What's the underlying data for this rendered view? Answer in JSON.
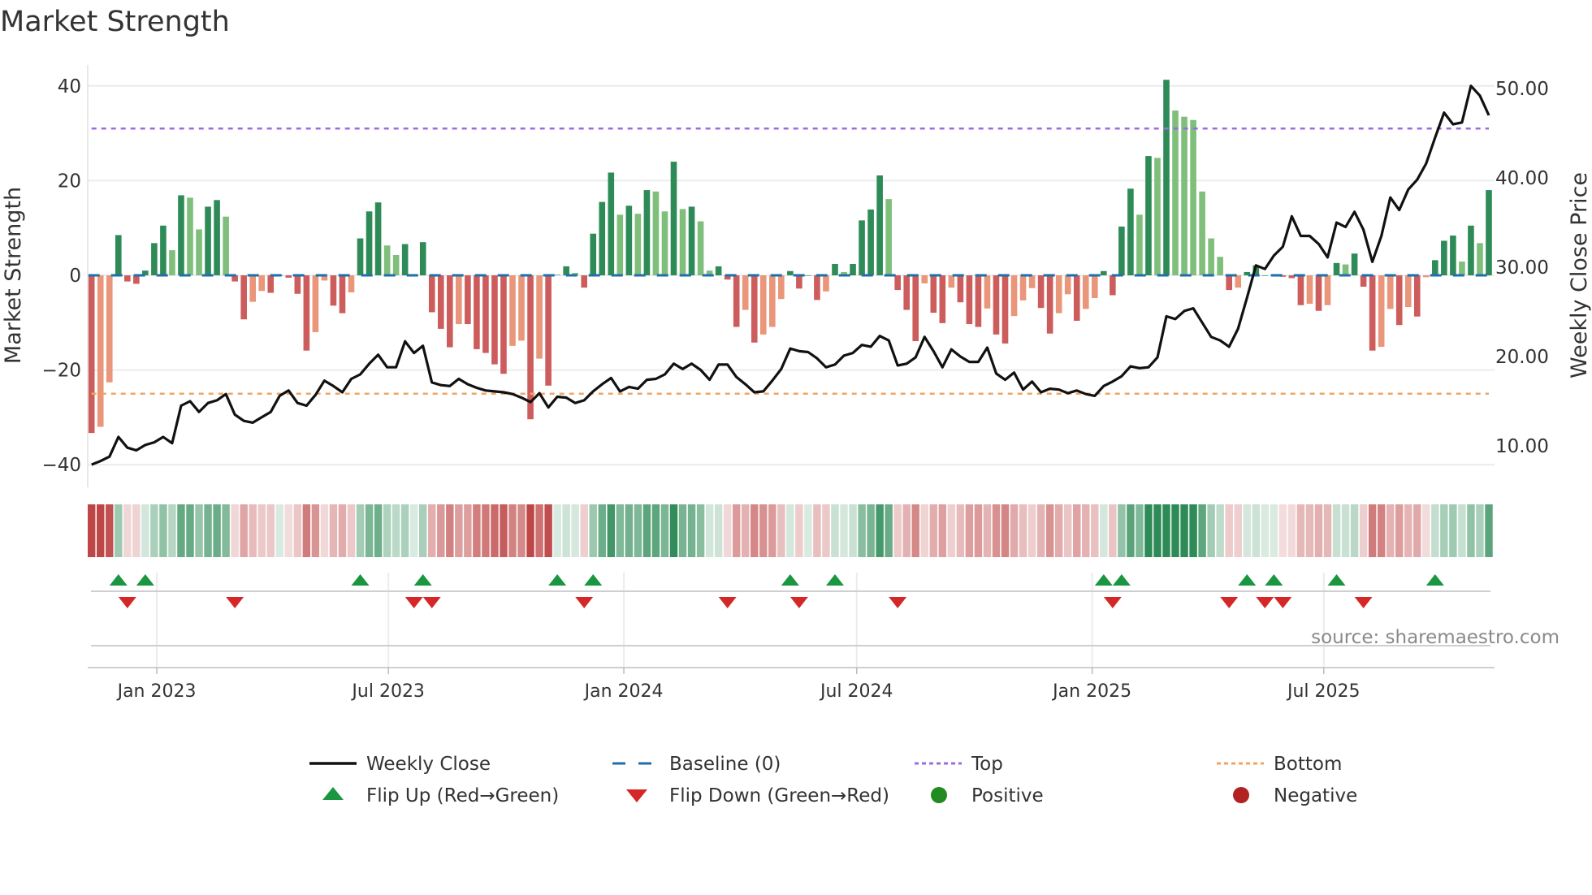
{
  "chart_data": {
    "type": "bar",
    "title": "Market Strength",
    "ylabel": "Market Strength",
    "y2label": "Weekly Close Price",
    "ylim": [
      -44,
      44
    ],
    "y_ticks": [
      40,
      20,
      0,
      -20,
      -40
    ],
    "y_tick_labels": [
      "40",
      "20",
      "0",
      "−20",
      "−40"
    ],
    "y2lim": [
      5,
      52
    ],
    "y2_ticks": [
      50,
      40,
      30,
      20,
      10
    ],
    "y2_tick_labels": [
      "50.00",
      "40.00",
      "30.00",
      "20.00",
      "10.00"
    ],
    "x_ticks": [
      "2023-01-01",
      "2023-07-01",
      "2024-01-01",
      "2024-07-01",
      "2025-01-01",
      "2025-07-01"
    ],
    "x_tick_labels": [
      "Jan 2023",
      "Jul 2023",
      "Jan 2024",
      "Jul 2024",
      "Jan 2025",
      "Jul 2025"
    ],
    "grid": true,
    "legend_position": "bottom",
    "top_level": 31,
    "bottom_level": -25,
    "dates": [
      "2022-11-11",
      "2022-11-18",
      "2022-11-25",
      "2022-12-02",
      "2022-12-09",
      "2022-12-16",
      "2022-12-23",
      "2022-12-30",
      "2023-01-06",
      "2023-01-13",
      "2023-01-20",
      "2023-01-27",
      "2023-02-03",
      "2023-02-10",
      "2023-02-17",
      "2023-02-24",
      "2023-03-03",
      "2023-03-10",
      "2023-03-17",
      "2023-03-24",
      "2023-03-31",
      "2023-04-07",
      "2023-04-14",
      "2023-04-21",
      "2023-04-28",
      "2023-05-05",
      "2023-05-12",
      "2023-05-19",
      "2023-05-26",
      "2023-06-02",
      "2023-06-09",
      "2023-06-16",
      "2023-06-23",
      "2023-06-30",
      "2023-07-07",
      "2023-07-14",
      "2023-07-21",
      "2023-07-28",
      "2023-08-04",
      "2023-08-11",
      "2023-08-18",
      "2023-08-25",
      "2023-09-01",
      "2023-09-08",
      "2023-09-15",
      "2023-09-22",
      "2023-09-29",
      "2023-10-06",
      "2023-10-13",
      "2023-10-20",
      "2023-10-27",
      "2023-11-03",
      "2023-11-10",
      "2023-11-17",
      "2023-11-24",
      "2023-12-01",
      "2023-12-08",
      "2023-12-15",
      "2023-12-22",
      "2023-12-29",
      "2024-01-05",
      "2024-01-12",
      "2024-01-19",
      "2024-01-26",
      "2024-02-02",
      "2024-02-09",
      "2024-02-16",
      "2024-02-23",
      "2024-03-01",
      "2024-03-08",
      "2024-03-15",
      "2024-03-22",
      "2024-03-29",
      "2024-04-05",
      "2024-04-12",
      "2024-04-19",
      "2024-04-26",
      "2024-05-03",
      "2024-05-10",
      "2024-05-17",
      "2024-05-24",
      "2024-05-31",
      "2024-06-07",
      "2024-06-14",
      "2024-06-21",
      "2024-06-28",
      "2024-07-05",
      "2024-07-12",
      "2024-07-19",
      "2024-07-26",
      "2024-08-02",
      "2024-08-09",
      "2024-08-16",
      "2024-08-23",
      "2024-08-30",
      "2024-09-06",
      "2024-09-13",
      "2024-09-20",
      "2024-09-27",
      "2024-10-04",
      "2024-10-11",
      "2024-10-18",
      "2024-10-25",
      "2024-11-01",
      "2024-11-08",
      "2024-11-15",
      "2024-11-22",
      "2024-11-29",
      "2024-12-06",
      "2024-12-13",
      "2024-12-20",
      "2024-12-27",
      "2025-01-03",
      "2025-01-10",
      "2025-01-17",
      "2025-01-24",
      "2025-01-31",
      "2025-02-07",
      "2025-02-14",
      "2025-02-21",
      "2025-02-28",
      "2025-03-07",
      "2025-03-14",
      "2025-03-21",
      "2025-03-28",
      "2025-04-04",
      "2025-04-11",
      "2025-04-18",
      "2025-04-25",
      "2025-05-02",
      "2025-05-09",
      "2025-05-16",
      "2025-05-23",
      "2025-05-30",
      "2025-06-06",
      "2025-06-13",
      "2025-06-20",
      "2025-06-27",
      "2025-07-04",
      "2025-07-11",
      "2025-07-18",
      "2025-07-25",
      "2025-08-01",
      "2025-08-08",
      "2025-08-15",
      "2025-08-22",
      "2025-08-29",
      "2025-09-05",
      "2025-09-12",
      "2025-09-19",
      "2025-09-26",
      "2025-10-03",
      "2025-10-10",
      "2025-10-17",
      "2025-10-24",
      "2025-10-31",
      "2025-11-07"
    ],
    "series": [
      {
        "name": "Market Strength",
        "axis": "left",
        "values": [
          -33.3,
          -32,
          -22.6,
          8.5,
          -1.3,
          -1.8,
          1,
          6.8,
          10.5,
          5.3,
          16.9,
          16.4,
          9.7,
          14.5,
          15.9,
          12.4,
          -1.3,
          -9.3,
          -5.6,
          -3.3,
          -3.7,
          0,
          -0.5,
          -3.9,
          -15.9,
          -12,
          -1.1,
          -6.4,
          -8,
          -3.6,
          7.8,
          13.5,
          15.4,
          6.3,
          4.3,
          6.6,
          0,
          7,
          -7.8,
          -11.3,
          -15.2,
          -10.3,
          -10.3,
          -15.6,
          -16.4,
          -18.8,
          -20.8,
          -14.9,
          -13.8,
          -30.4,
          -17.6,
          -23.3,
          0.1,
          1.9,
          0.5,
          -2.6,
          8.8,
          15.5,
          21.7,
          12.8,
          14.7,
          13,
          18,
          17.7,
          13.5,
          24,
          14,
          14.5,
          11.4,
          1,
          1.9,
          -0.9,
          -10.9,
          -7.3,
          -14.2,
          -12.5,
          -10.9,
          -5,
          0.9,
          -2.8,
          0,
          -5.2,
          -3.4,
          2.4,
          0.7,
          2.4,
          11.6,
          13.9,
          21.1,
          16.1,
          -3.1,
          -7.3,
          -13.9,
          -1.7,
          -7.9,
          -10.1,
          -2.6,
          -5.7,
          -10.3,
          -10.9,
          -7,
          -12.5,
          -14.4,
          -8.6,
          -5.3,
          -2.7,
          -6.9,
          -12.3,
          -8,
          -4,
          -9.6,
          -7.1,
          -4.8,
          0.9,
          -4.2,
          10.3,
          18.3,
          12.8,
          25.2,
          24.8,
          41.3,
          34.8,
          33.5,
          32.8,
          17.7,
          7.8,
          3.9,
          -3.1,
          -2.6,
          0.7,
          2.1,
          0,
          0,
          -0.3,
          -0.6,
          -6.3,
          -6,
          -7.5,
          -6.3,
          2.6,
          2.3,
          4.6,
          -2.4,
          -15.9,
          -15.1,
          -7.1,
          -10.5,
          -6.7,
          -8.7,
          -0.4,
          3.2,
          7.3,
          8.4,
          2.9,
          10.5,
          6.8,
          18
        ]
      },
      {
        "name": "Weekly Close",
        "axis": "right",
        "type": "line",
        "values": [
          7.9,
          8.3,
          8.8,
          11.0,
          9.8,
          9.5,
          10.1,
          10.4,
          11.0,
          10.3,
          14.5,
          15.0,
          13.8,
          14.8,
          15.1,
          15.8,
          13.5,
          12.8,
          12.6,
          13.2,
          13.8,
          15.6,
          16.2,
          14.8,
          14.5,
          15.7,
          17.3,
          16.7,
          16.0,
          17.5,
          18.0,
          19.2,
          20.2,
          18.8,
          18.8,
          21.7,
          20.4,
          21.2,
          17.1,
          16.8,
          16.7,
          17.5,
          16.9,
          16.5,
          16.2,
          16.1,
          16.0,
          15.8,
          15.4,
          14.9,
          15.9,
          14.3,
          15.5,
          15.4,
          14.8,
          15.1,
          16.1,
          16.9,
          17.6,
          16.1,
          16.6,
          16.4,
          17.4,
          17.5,
          18.0,
          19.2,
          18.6,
          19.2,
          18.5,
          17.4,
          19.1,
          19.1,
          17.7,
          16.9,
          16.0,
          16.1,
          17.3,
          18.6,
          20.9,
          20.6,
          20.5,
          19.8,
          18.8,
          19.1,
          20.1,
          20.4,
          21.3,
          21.1,
          22.3,
          21.8,
          19.0,
          19.2,
          19.9,
          22.2,
          20.6,
          18.8,
          20.8,
          20.0,
          19.4,
          19.4,
          21.0,
          18.1,
          17.4,
          18.2,
          16.3,
          17.2,
          16.0,
          16.4,
          16.3,
          15.9,
          16.2,
          15.8,
          15.6,
          16.7,
          17.2,
          17.8,
          18.9,
          18.7,
          18.8,
          19.9,
          24.5,
          24.2,
          25.1,
          25.4,
          23.8,
          22.2,
          21.8,
          21.1,
          23.1,
          26.6,
          30.2,
          29.8,
          31.3,
          32.3,
          35.7,
          33.5,
          33.5,
          32.6,
          31.1,
          35.0,
          34.5,
          36.2,
          34.2,
          30.6,
          33.5,
          37.8,
          36.4,
          38.7,
          39.8,
          41.6,
          44.5,
          47.3,
          46.0,
          46.2,
          50.3,
          49.2,
          47.0
        ]
      }
    ],
    "flip_up_dates": [
      "2022-12-02",
      "2022-12-23",
      "2023-06-09",
      "2023-07-28",
      "2023-11-10",
      "2023-12-08",
      "2024-05-10",
      "2024-06-14",
      "2025-01-10",
      "2025-01-24",
      "2025-05-02",
      "2025-05-23",
      "2025-07-11",
      "2025-09-26"
    ],
    "flip_down_dates": [
      "2022-12-09",
      "2023-03-03",
      "2023-07-21",
      "2023-08-04",
      "2023-12-01",
      "2024-03-22",
      "2024-05-17",
      "2024-08-02",
      "2025-01-17",
      "2025-04-18",
      "2025-05-16",
      "2025-05-30",
      "2025-08-01"
    ]
  },
  "colors": {
    "positive_strong": "#2e8b57",
    "positive_weak": "#7fbf7b",
    "negative_strong": "#cd5c5c",
    "negative_weak": "#e9967a",
    "weekly_close": "#111111",
    "baseline": "#1f6fa8",
    "top": "#9b6ddf",
    "bottom": "#f4a460",
    "flip_up": "#1a9641",
    "flip_down": "#d62728",
    "positive_dot": "#228b22",
    "negative_dot": "#b22222"
  },
  "source_note": "source: sharemaestro.com",
  "legend": {
    "weekly_close": "Weekly Close",
    "baseline": "Baseline (0)",
    "top": "Top",
    "bottom": "Bottom",
    "flip_up": "Flip Up (Red→Green)",
    "flip_down": "Flip Down (Green→Red)",
    "positive": "Positive",
    "negative": "Negative"
  }
}
